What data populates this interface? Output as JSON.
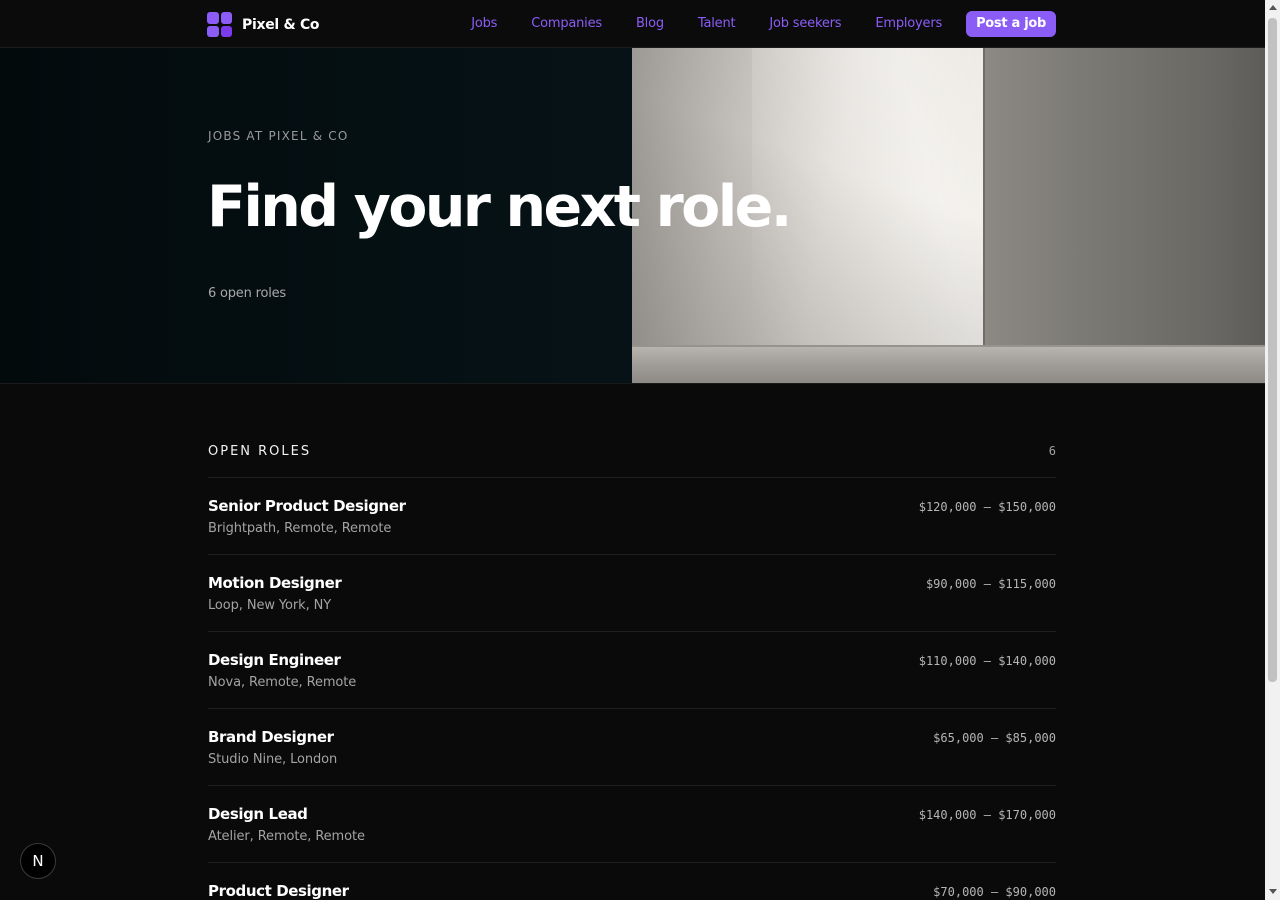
{
  "nav": {
    "brand": "Pixel & Co",
    "links": [
      "Jobs",
      "Companies",
      "Blog",
      "Talent",
      "Job seekers",
      "Employers"
    ],
    "cta": "Post a job",
    "accent": "#8b5cf6"
  },
  "hero": {
    "eyebrow": "JOBS AT PIXEL & CO",
    "title": "Find your next role.",
    "count": "6 open roles"
  },
  "roles": {
    "title": "OPEN ROLES",
    "count": "6",
    "items": [
      {
        "title": "Senior Product Designer",
        "meta": "Brightpath, Remote, Remote",
        "salary": "$120,000 – $150,000"
      },
      {
        "title": "Motion Designer",
        "meta": "Loop, New York, NY",
        "salary": "$90,000 – $115,000"
      },
      {
        "title": "Design Engineer",
        "meta": "Nova, Remote, Remote",
        "salary": "$110,000 – $140,000"
      },
      {
        "title": "Brand Designer",
        "meta": "Studio Nine, London",
        "salary": "$65,000 – $85,000"
      },
      {
        "title": "Design Lead",
        "meta": "Atelier, Remote, Remote",
        "salary": "$140,000 – $170,000"
      },
      {
        "title": "Product Designer",
        "meta": "",
        "salary": "$70,000 – $90,000"
      }
    ]
  },
  "badge": "N"
}
